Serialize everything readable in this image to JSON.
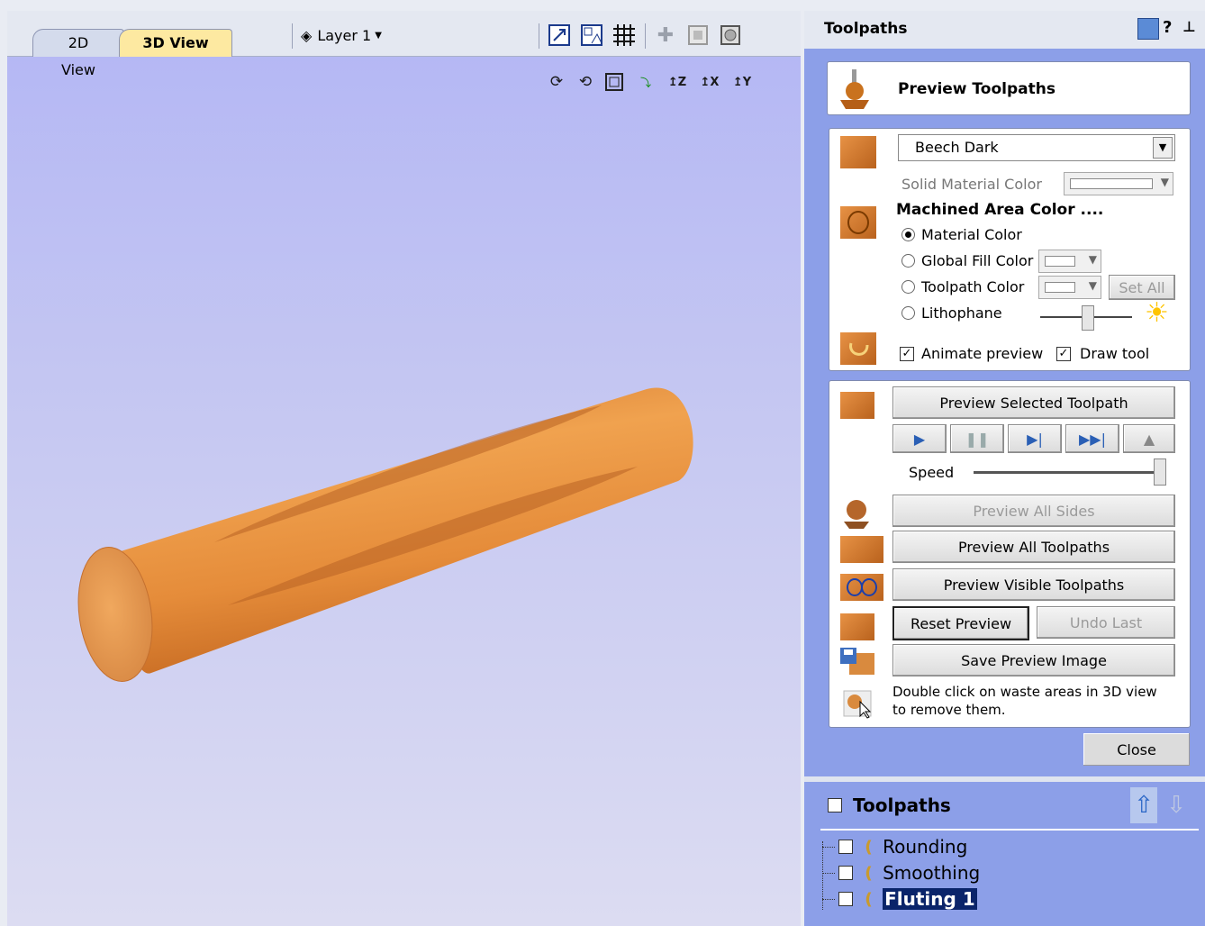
{
  "viewport": {
    "tabs": [
      {
        "label": "2D View"
      },
      {
        "label": "3D View"
      }
    ],
    "layer_label": "Layer 1"
  },
  "panel": {
    "title": "Toolpaths",
    "header_icons": [
      "dock-icon",
      "help-icon",
      "pin-icon"
    ],
    "preview_title": "Preview Toolpaths",
    "material": {
      "selected": "Beech Dark",
      "solid_material_color_label": "Solid Material Color",
      "machined_area_heading": "Machined Area Color ....",
      "options": [
        {
          "label": "Material Color",
          "selected": true
        },
        {
          "label": "Global Fill Color",
          "selected": false
        },
        {
          "label": "Toolpath Color",
          "selected": false
        },
        {
          "label": "Lithophane",
          "selected": false
        }
      ],
      "set_all_label": "Set All",
      "animate_preview_label": "Animate preview",
      "animate_preview_checked": true,
      "draw_tool_label": "Draw tool",
      "draw_tool_checked": true
    },
    "actions": {
      "preview_selected": "Preview Selected Toolpath",
      "speed_label": "Speed",
      "speed_value": 1.0,
      "preview_all_sides": "Preview All Sides",
      "preview_all_toolpaths": "Preview All Toolpaths",
      "preview_visible_toolpaths": "Preview Visible Toolpaths",
      "reset_preview": "Reset Preview",
      "undo_last": "Undo Last",
      "save_preview_image": "Save Preview Image",
      "hint_line1": "Double click on waste areas in 3D view",
      "hint_line2": "to remove them."
    },
    "close_label": "Close",
    "list": {
      "title": "Toolpaths",
      "items": [
        {
          "label": "Rounding",
          "selected": false
        },
        {
          "label": "Smoothing",
          "selected": false
        },
        {
          "label": "Fluting 1",
          "selected": true
        }
      ]
    }
  },
  "colors": {
    "panel_bg": "#8c9fe8",
    "viewport_top": "#b3b6f4",
    "material": "#e08a3c",
    "selection": "#0a246a"
  }
}
